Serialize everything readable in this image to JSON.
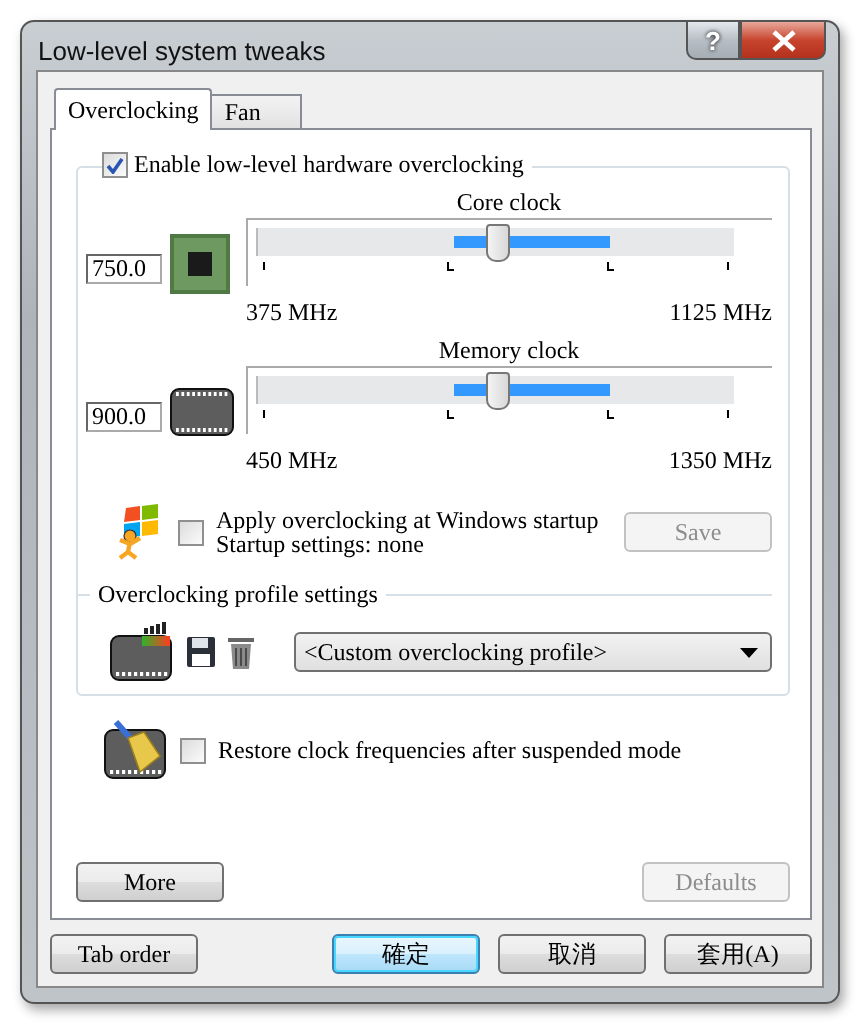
{
  "window": {
    "title": "Low-level system tweaks",
    "help": "?"
  },
  "tabs": [
    {
      "label": "Overclocking",
      "selected": true
    },
    {
      "label": "Fan",
      "selected": false
    }
  ],
  "overclocking": {
    "enable": {
      "label": "Enable low-level hardware overclocking",
      "checked": true
    },
    "clocks": [
      {
        "kind": "core",
        "label": "Core clock",
        "value": "750.0",
        "level": 0.5,
        "min": "375 MHz",
        "max": "1125 MHz"
      },
      {
        "kind": "memory",
        "label": "Memory clock",
        "value": "900.0",
        "level": 0.5,
        "min": "450 MHz",
        "max": "1350 MHz"
      }
    ],
    "startup": {
      "label": "Apply overclocking at Windows startup",
      "checked": false,
      "status": "Startup settings: none",
      "save_button": {
        "label": "Save",
        "disabled": true
      }
    },
    "profile": {
      "heading": "Overclocking profile settings",
      "selected_profile": "<Custom overclocking profile>"
    },
    "restore": {
      "label": "Restore clock frequencies after suspended mode",
      "checked": false
    },
    "more_button": {
      "label": "More",
      "disabled": false
    },
    "defaults_button": {
      "label": "Defaults",
      "disabled": true
    }
  },
  "buttons": [
    {
      "label": "Tab order",
      "focused": false
    },
    {
      "label": "確定",
      "focused": true
    },
    {
      "label": "取消",
      "focused": false
    },
    {
      "label": "套用(A)",
      "focused": false
    }
  ]
}
